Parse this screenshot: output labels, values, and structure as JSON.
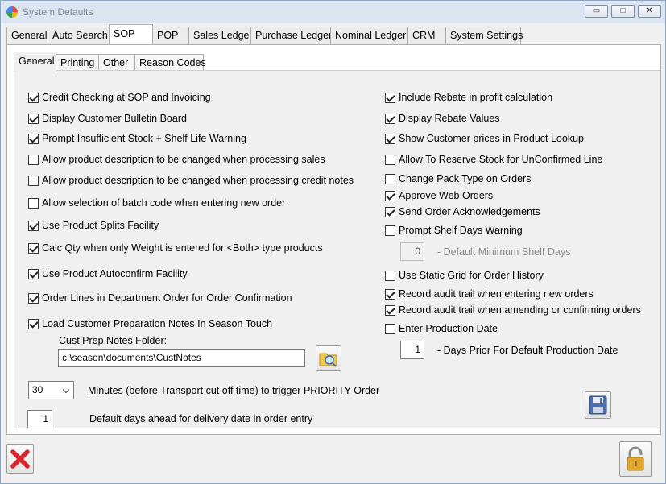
{
  "window": {
    "title": "System Defaults",
    "minimize_label": "▭",
    "maximize_label": "□",
    "close_label": "✕"
  },
  "outer_tabs": [
    {
      "label": "General",
      "active": false
    },
    {
      "label": "Auto Search",
      "active": false
    },
    {
      "label": "SOP",
      "active": true
    },
    {
      "label": "POP",
      "active": false
    },
    {
      "label": "Sales Ledger",
      "active": false
    },
    {
      "label": "Purchase Ledger",
      "active": false
    },
    {
      "label": "Nominal Ledger",
      "active": false
    },
    {
      "label": "CRM",
      "active": false
    },
    {
      "label": "System Settings",
      "active": false
    }
  ],
  "inner_tabs": [
    {
      "label": "General",
      "active": true
    },
    {
      "label": "Printing",
      "active": false
    },
    {
      "label": "Other",
      "active": false
    },
    {
      "label": "Reason Codes",
      "active": false
    }
  ],
  "left_options": [
    {
      "label": "Credit Checking at SOP and Invoicing",
      "checked": true
    },
    {
      "label": "Display Customer Bulletin Board",
      "checked": true
    },
    {
      "label": "Prompt Insufficient Stock + Shelf Life Warning",
      "checked": true
    },
    {
      "label": "Allow product description to be changed when processing sales",
      "checked": false
    },
    {
      "label": "Allow product description to be changed when processing credit notes",
      "checked": false
    },
    {
      "label": "Allow selection of batch code when entering new order",
      "checked": false
    },
    {
      "label": "Use Product Splits Facility",
      "checked": true
    },
    {
      "label": "Calc Qty when only Weight is entered for <Both> type products",
      "checked": true
    },
    {
      "label": "Use Product Autoconfirm Facility",
      "checked": true
    },
    {
      "label": "Order Lines in Department Order for Order Confirmation",
      "checked": true
    },
    {
      "label": "Load Customer Preparation Notes In Season Touch",
      "checked": true
    }
  ],
  "right_options": [
    {
      "label": "Include Rebate in profit calculation",
      "checked": true
    },
    {
      "label": "Display Rebate Values",
      "checked": true
    },
    {
      "label": "Show Customer prices in Product Lookup",
      "checked": true
    },
    {
      "label": "Allow To Reserve Stock for UnConfirmed Line",
      "checked": false
    },
    {
      "label": "Change Pack Type on Orders",
      "checked": false
    },
    {
      "label": "Approve Web Orders",
      "checked": true
    },
    {
      "label": "Send Order Acknowledgements",
      "checked": true
    },
    {
      "label": "Prompt Shelf Days Warning",
      "checked": false
    },
    {
      "label": "Use Static Grid for Order History",
      "checked": false
    },
    {
      "label": "Record audit trail when entering new orders",
      "checked": true
    },
    {
      "label": "Record audit trail when amending or confirming orders",
      "checked": true
    },
    {
      "label": "Enter Production Date",
      "checked": false
    }
  ],
  "cust_prep": {
    "label": "Cust Prep Notes Folder:",
    "path": "c:\\season\\documents\\CustNotes"
  },
  "shelf_days": {
    "value": "0",
    "label": "- Default Minimum Shelf Days"
  },
  "production": {
    "value": "1",
    "label": "- Days Prior For Default Production Date"
  },
  "priority": {
    "value": "30",
    "label": "Minutes (before Transport cut off time) to trigger  PRIORITY Order"
  },
  "delivery": {
    "value": "1",
    "label": "Default days ahead for delivery date in order entry"
  },
  "colors": {
    "cancel_red": "#d9262c",
    "lock_gold": "#e2a72a",
    "save_blue": "#4a6fb0"
  },
  "icons": {
    "folder_search": "folder-search-icon",
    "save": "floppy-disk-icon",
    "cancel": "red-x-icon",
    "lock": "padlock-icon"
  }
}
